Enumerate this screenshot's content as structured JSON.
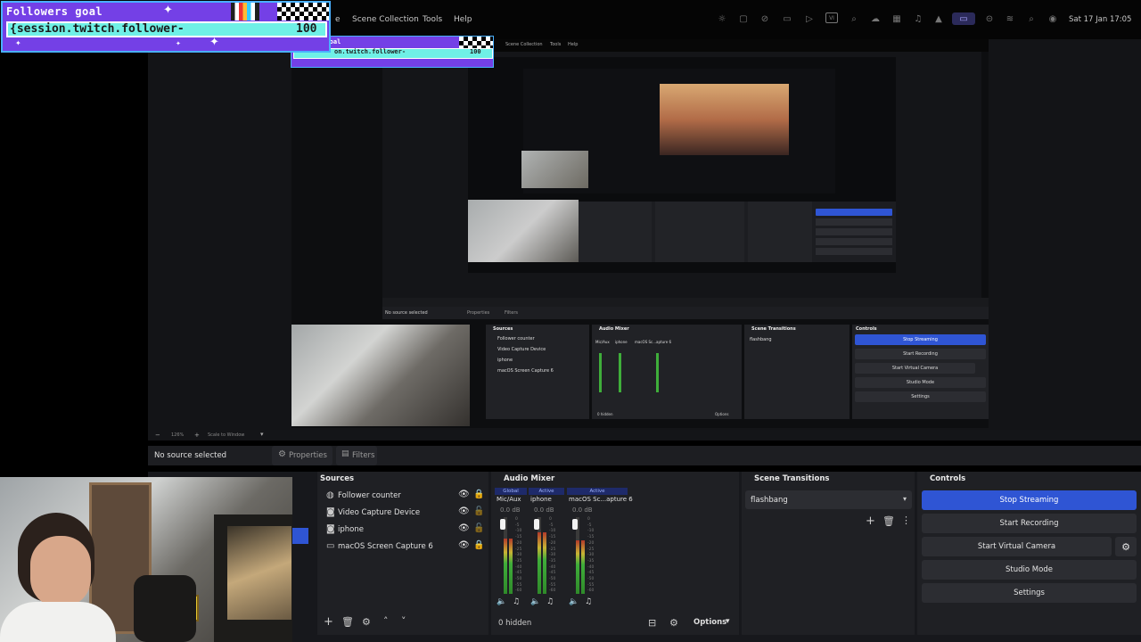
{
  "menu": {
    "items": [
      "e",
      "Scene Collection",
      "Tools",
      "Help"
    ],
    "clock": "Sat 17 Jan  17:05"
  },
  "overlay": {
    "title": "Followers goal",
    "text": "{session.twitch.follower-",
    "goal": "100"
  },
  "properties_bar": {
    "no_source": "No source selected",
    "properties": "Properties",
    "filters": "Filters"
  },
  "sources": {
    "title": "Sources",
    "items": [
      "Follower counter",
      "Video Capture Device",
      "iphone",
      "macOS Screen Capture 6"
    ],
    "hidden_count": "0 hidden"
  },
  "mixer": {
    "title": "Audio Mixer",
    "channels": [
      {
        "tag": "Global",
        "name": "Mic/Aux",
        "db": "0.0 dB",
        "level": 0.72
      },
      {
        "tag": "Active",
        "name": "iphone",
        "db": "0.0 dB",
        "level": 0.8
      },
      {
        "tag": "Active",
        "name": "macOS Sc...apture 6",
        "db": "0.0 dB",
        "level": 0.7
      }
    ],
    "scale": [
      "0",
      "-5",
      "-10",
      "-15",
      "-20",
      "-25",
      "-30",
      "-35",
      "-40",
      "-45",
      "-50",
      "-55",
      "-60"
    ],
    "options": "Options"
  },
  "transitions": {
    "title": "Scene Transitions",
    "selected": "flashbang"
  },
  "controls": {
    "title": "Controls",
    "stop_streaming": "Stop Streaming",
    "start_recording": "Start Recording",
    "start_virtual_camera": "Start Virtual Camera",
    "studio_mode": "Studio Mode",
    "settings": "Settings",
    "accent": "#2f55d4"
  },
  "nested": {
    "menu_items": [
      "Scene Collection",
      "Tools",
      "Help"
    ],
    "no_source": "No source selected",
    "properties": "Properties",
    "filters": "Filters",
    "sources": [
      "Follower counter",
      "Video Capture Device",
      "iphone",
      "macOS Screen Capture 6"
    ],
    "sources_title": "Sources",
    "mixer_title": "Audio Mixer",
    "transitions_title": "Scene Transitions",
    "transition": "flashbang",
    "controls_title": "Controls",
    "buttons": [
      "Stop Streaming",
      "Start Recording",
      "Start Virtual Camera",
      "Studio Mode",
      "Settings"
    ],
    "hidden": "0 hidden",
    "options": "Options",
    "channels": [
      "Mic/Aux",
      "iphone",
      "macOS Sc...apture 6"
    ],
    "zoom": "126%",
    "scale_to_window": "Scale to Window",
    "overlay_title": "s goal",
    "overlay_text": "on.twitch.follower-",
    "overlay_goal": "100"
  }
}
